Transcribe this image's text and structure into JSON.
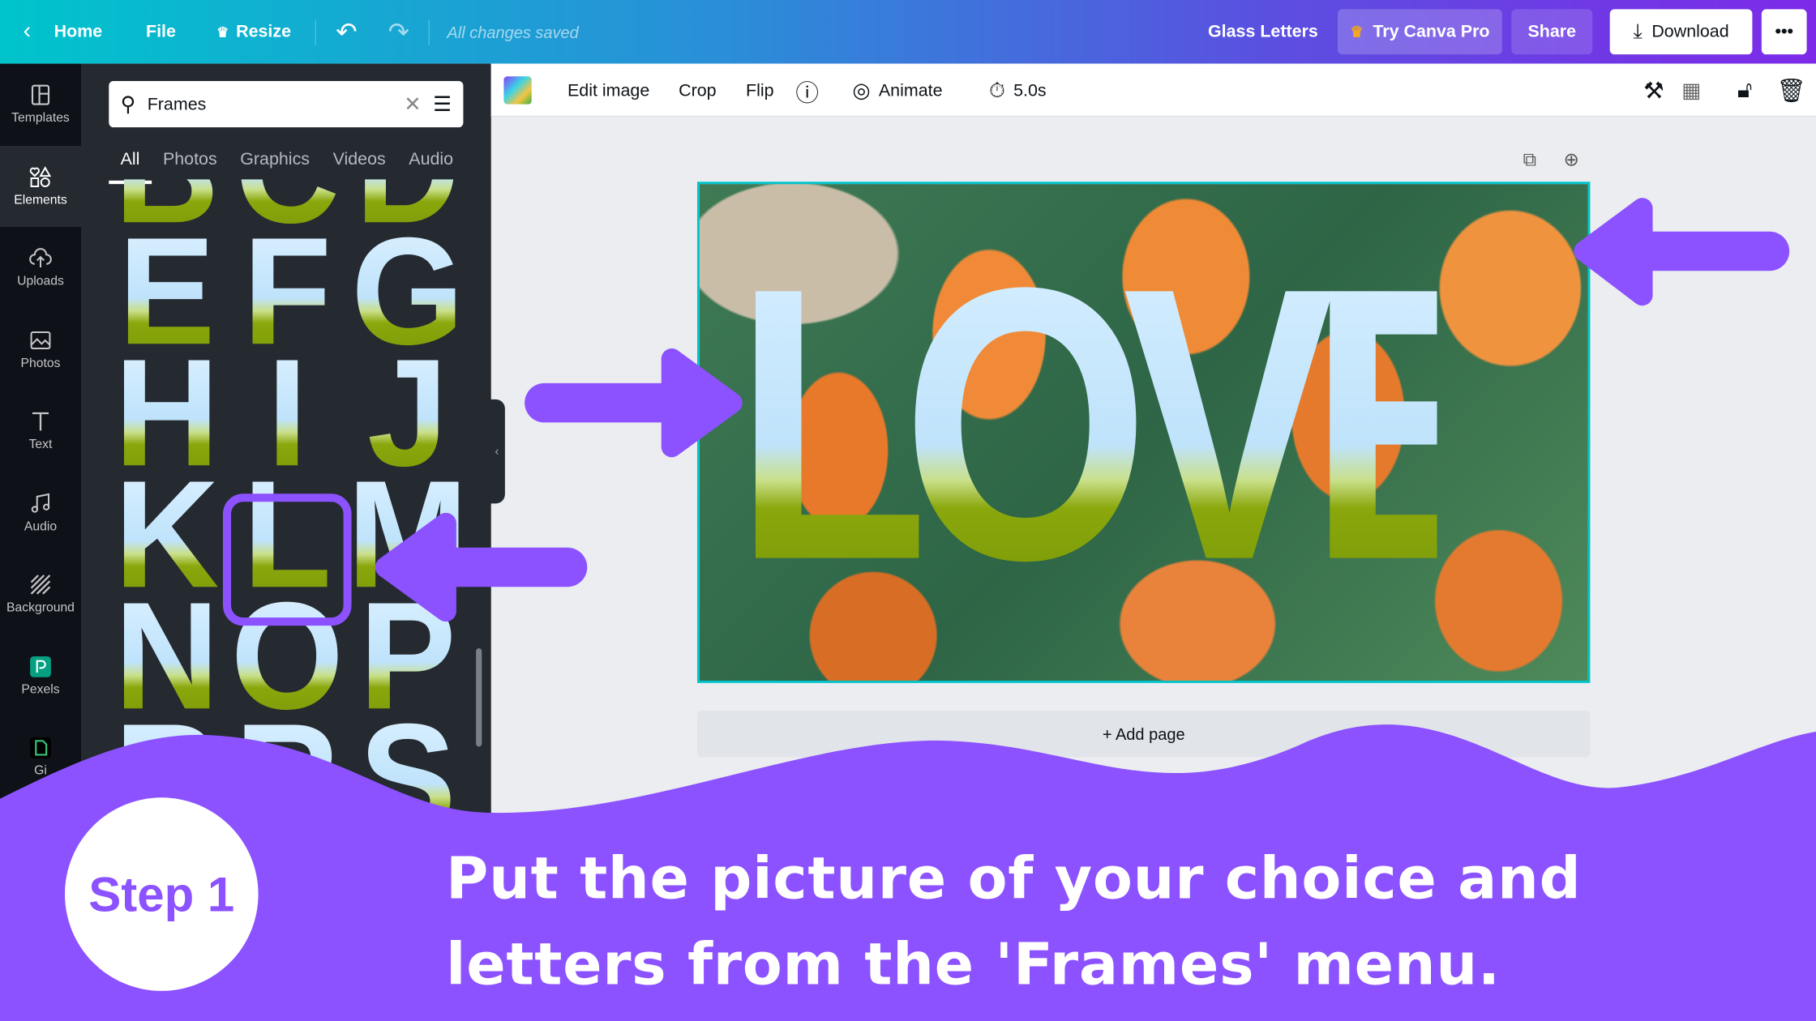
{
  "topbar": {
    "home": "Home",
    "file": "File",
    "resize": "Resize",
    "status": "All changes saved",
    "title": "Glass Letters",
    "try_pro": "Try Canva Pro",
    "share": "Share",
    "download": "Download",
    "more": "•••"
  },
  "rail": [
    {
      "label": "Templates",
      "icon": "templates-icon"
    },
    {
      "label": "Elements",
      "icon": "elements-icon"
    },
    {
      "label": "Uploads",
      "icon": "upload-icon"
    },
    {
      "label": "Photos",
      "icon": "photos-icon"
    },
    {
      "label": "Text",
      "icon": "text-icon"
    },
    {
      "label": "Audio",
      "icon": "audio-icon"
    },
    {
      "label": "Background",
      "icon": "background-icon"
    },
    {
      "label": "Pexels",
      "icon": "pexels-icon"
    },
    {
      "label": "Gi",
      "icon": "app-icon"
    }
  ],
  "panel": {
    "search_value": "Frames",
    "tabs": [
      "All",
      "Photos",
      "Graphics",
      "Videos",
      "Audio"
    ],
    "active_tab": "All",
    "letters": [
      "B",
      "C",
      "D",
      "E",
      "F",
      "G",
      "H",
      "I",
      "J",
      "K",
      "L",
      "M",
      "N",
      "O",
      "P",
      "R",
      "R",
      "S"
    ],
    "selected_letter": "L"
  },
  "toolbar": {
    "edit_image": "Edit image",
    "crop": "Crop",
    "flip": "Flip",
    "animate": "Animate",
    "duration": "5.0s"
  },
  "canvas": {
    "frame_text": "LOVE",
    "add_page": "+ Add page"
  },
  "tutorial": {
    "step": "Step 1",
    "caption": "Put the picture of your choice and letters from the 'Frames' menu.",
    "accent": "#8c52ff"
  }
}
